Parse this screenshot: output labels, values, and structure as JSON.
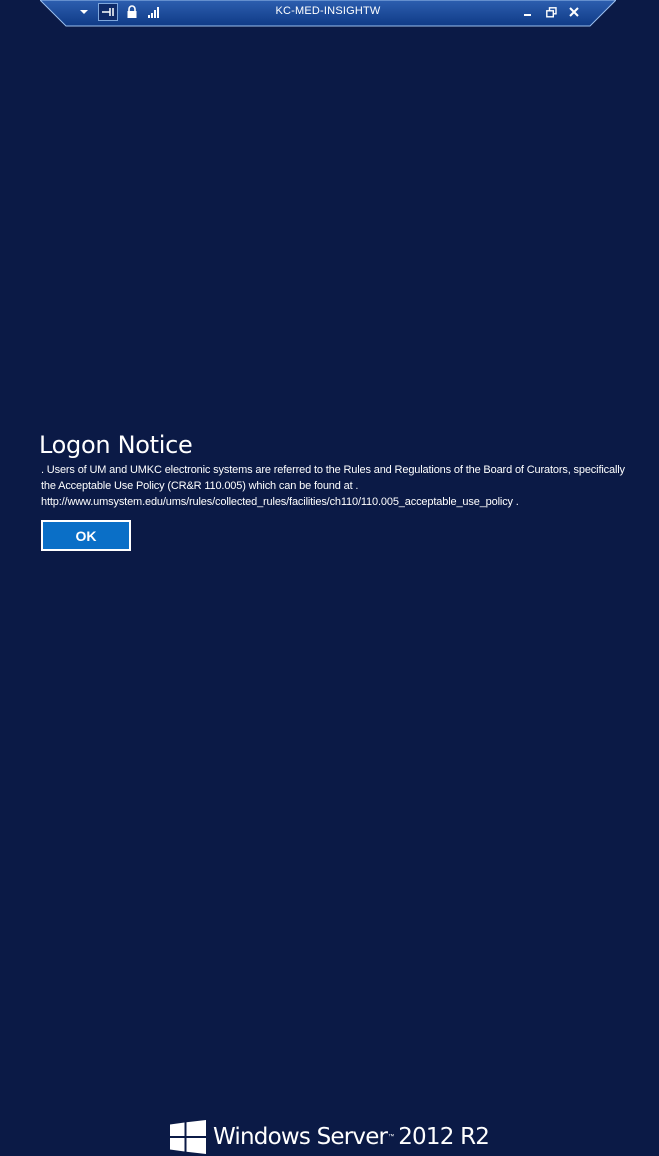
{
  "connection_bar": {
    "title": "KC-MED-INSIGHTW",
    "icons": [
      "chevron-down-icon",
      "pin-icon",
      "lock-icon",
      "signal-strength-icon"
    ],
    "controls": [
      "minimize-icon",
      "restore-icon",
      "close-icon"
    ]
  },
  "notice": {
    "title": "Logon Notice",
    "body": ". Users of UM and UMKC electronic systems are referred to the Rules and Regulations of the Board of Curators, specifically the Acceptable Use Policy (CR&R 110.005) which can be found at .  http://www.umsystem.edu/ums/rules/collected_rules/facilities/ch110/110.005_acceptable_use_policy .",
    "ok_label": "OK"
  },
  "branding": {
    "product": "Windows Server",
    "version": "2012 R2",
    "logo": "windows-logo-icon"
  },
  "colors": {
    "background": "#0b1a46",
    "button": "#0a6fc7",
    "connection_bar": "#0f3a86"
  }
}
